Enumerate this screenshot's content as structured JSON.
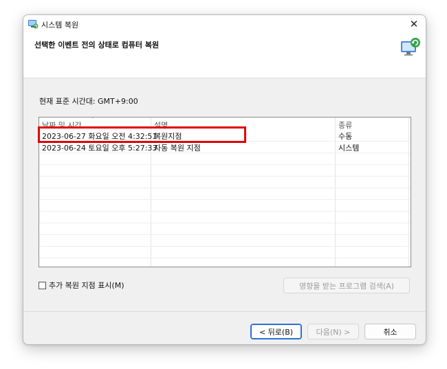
{
  "window": {
    "title": "시스템 복원",
    "close_glyph": "✕"
  },
  "header": {
    "title": "선택한 이벤트 전의 상태로 컴퓨터 복원",
    "icon": "system-restore-icon"
  },
  "timezone_label": "현재 표준 시간대: GMT+9:00",
  "table": {
    "columns": [
      "날짜 및 시간",
      "설명",
      "종류"
    ],
    "sort_indicator": "˅",
    "rows": [
      {
        "datetime": "2023-06-27 화요일 오전 4:32:51",
        "description": "복원지점",
        "type": "수동"
      },
      {
        "datetime": "2023-06-24 토요일 오후 5:27:33",
        "description": "자동 복원 지점",
        "type": "시스템"
      }
    ]
  },
  "checkbox": {
    "label": "추가 복원 지점 표시(M)",
    "checked": false
  },
  "buttons": {
    "scan": "영향을 받는 프로그램 검색(A)",
    "back": "< 뒤로(B)",
    "next": "다음(N) >",
    "cancel": "취소"
  },
  "colors": {
    "highlight": "#e00000",
    "primary_border": "#2a6fd6"
  }
}
